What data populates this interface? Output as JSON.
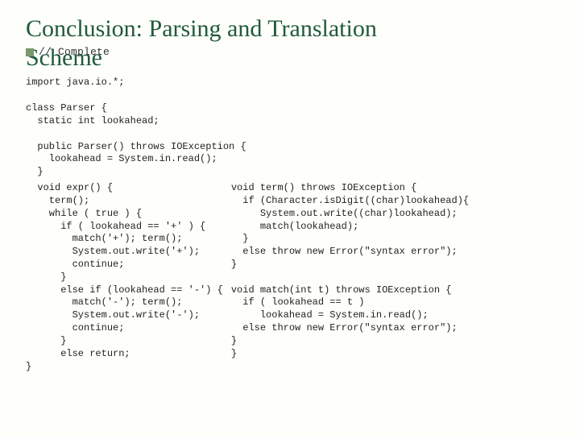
{
  "title_line1": "Conclusion: Parsing and Translation",
  "title_line2": "Scheme",
  "bullet_overlay": "// Complete",
  "code_top": "import java.io.*;\n\nclass Parser {\n  static int lookahead;\n\n  public Parser() throws IOException {\n    lookahead = System.in.read();\n  }",
  "code_left": "  void expr() {\n    term();\n    while ( true ) {\n      if ( lookahead == '+' ) {\n        match('+'); term();\n        System.out.write('+');\n        continue;\n      }\n      else if (lookahead == '-') {\n        match('-'); term();\n        System.out.write('-');\n        continue;\n      }\n      else return;\n}",
  "code_right": "void term() throws IOException {\n  if (Character.isDigit((char)lookahead){\n     System.out.write((char)lookahead);\n     match(lookahead);\n  }\n  else throw new Error(\"syntax error\");\n}\n\nvoid match(int t) throws IOException {\n  if ( lookahead == t )\n     lookahead = System.in.read();\n  else throw new Error(\"syntax error\");\n}\n}"
}
